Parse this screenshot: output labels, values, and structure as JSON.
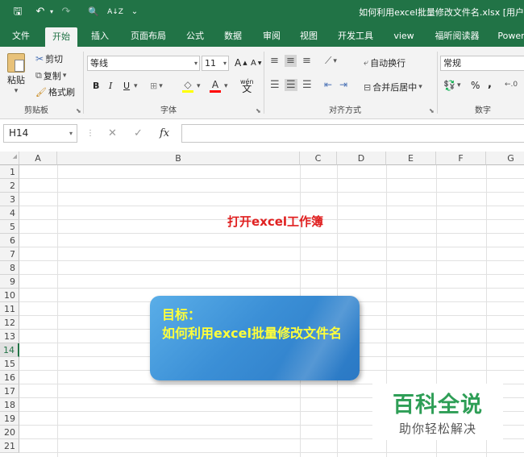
{
  "window": {
    "title": "如何利用excel批量修改文件名.xlsx [用户",
    "quick_access": {
      "save": "🖫",
      "undo": "↶",
      "redo": "↷",
      "print_preview": "🔍",
      "sort": "A↓Z",
      "customize": "⌄"
    }
  },
  "tabs": [
    "文件",
    "开始",
    "插入",
    "页面布局",
    "公式",
    "数据",
    "审阅",
    "视图",
    "开发工具",
    "view",
    "福昕阅读器",
    "Power"
  ],
  "ribbon": {
    "clipboard": {
      "paste": "粘贴",
      "cut": "剪切",
      "copy": "复制",
      "format_painter": "格式刷",
      "label": "剪贴板"
    },
    "font": {
      "font_name": "等线",
      "font_size": "11",
      "grow": "A",
      "shrink": "A",
      "bold": "B",
      "italic": "I",
      "underline": "U",
      "label": "字体",
      "wen": "wén"
    },
    "alignment": {
      "wrap_text": "自动换行",
      "merge_center": "合并后居中",
      "label": "对齐方式"
    },
    "number": {
      "format": "常规",
      "percent": "%",
      "comma": ",",
      "label": "数字"
    }
  },
  "formula_bar": {
    "name_box": "H14",
    "cancel": "✕",
    "enter": "✓",
    "fx": "fx",
    "value": ""
  },
  "columns": [
    "A",
    "B",
    "C",
    "D",
    "E",
    "F",
    "G"
  ],
  "rows": [
    "1",
    "2",
    "3",
    "4",
    "5",
    "6",
    "7",
    "8",
    "9",
    "10",
    "11",
    "12",
    "13",
    "14",
    "15",
    "16",
    "17",
    "18",
    "19",
    "20",
    "21"
  ],
  "active_row": "14",
  "cells": {
    "red_text": "打开excel工作簿"
  },
  "callout": {
    "line1": "目标：",
    "line2": "如何利用excel批量修改文件名"
  },
  "watermark": {
    "brand": "百科全说",
    "slogan": "助你轻松解决"
  },
  "colors": {
    "excel_green": "#217346",
    "red_text": "#e02020",
    "callout_text": "#ffff3a",
    "brand_green": "#2e9e56"
  }
}
